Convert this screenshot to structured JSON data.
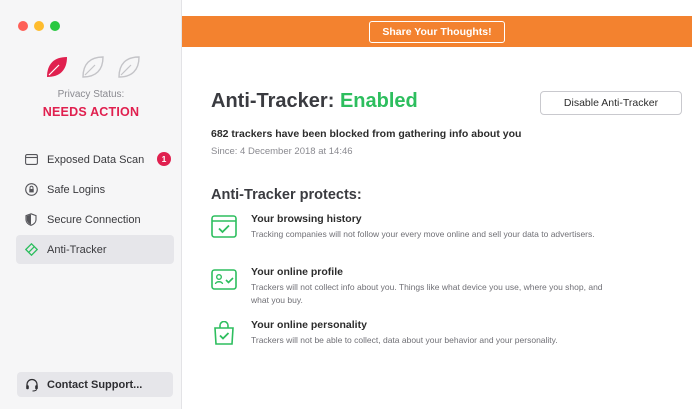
{
  "window": {
    "traffic_colors": [
      "#fe5f57",
      "#febc2e",
      "#28c840"
    ]
  },
  "sidebar": {
    "status_label": "Privacy Status:",
    "status_value": "NEEDS ACTION",
    "status_color": "#e0204f",
    "items": [
      {
        "label": "Exposed Data Scan",
        "icon": "card-icon",
        "badge": "1",
        "active": false
      },
      {
        "label": "Safe Logins",
        "icon": "lock-icon",
        "active": false
      },
      {
        "label": "Secure Connection",
        "icon": "shield-icon",
        "active": false
      },
      {
        "label": "Anti-Tracker",
        "icon": "anti-tracker-icon",
        "active": true
      }
    ],
    "support_label": "Contact Support..."
  },
  "banner": {
    "button_label": "Share Your Thoughts!",
    "color": "#f3822f"
  },
  "main": {
    "title_prefix": "Anti-Tracker:",
    "title_state": "Enabled",
    "state_color": "#2dbe5e",
    "disable_label": "Disable Anti-Tracker",
    "blocked_text": "682 trackers have been blocked from gathering info about you",
    "since_text": "Since: 4 December 2018 at 14:46",
    "protects_heading": "Anti-Tracker protects:",
    "features": [
      {
        "title": "Your browsing history",
        "desc": "Tracking companies will not follow your every move online and sell your data to advertisers.",
        "icon": "browser-check-icon"
      },
      {
        "title": "Your online profile",
        "desc": "Trackers will not collect info about you. Things like what device you use, where you shop, and what you buy.",
        "icon": "profile-card-icon"
      },
      {
        "title": "Your online personality",
        "desc": "Trackers will not be able to collect, data about your behavior and your personality.",
        "icon": "bag-check-icon"
      }
    ]
  }
}
